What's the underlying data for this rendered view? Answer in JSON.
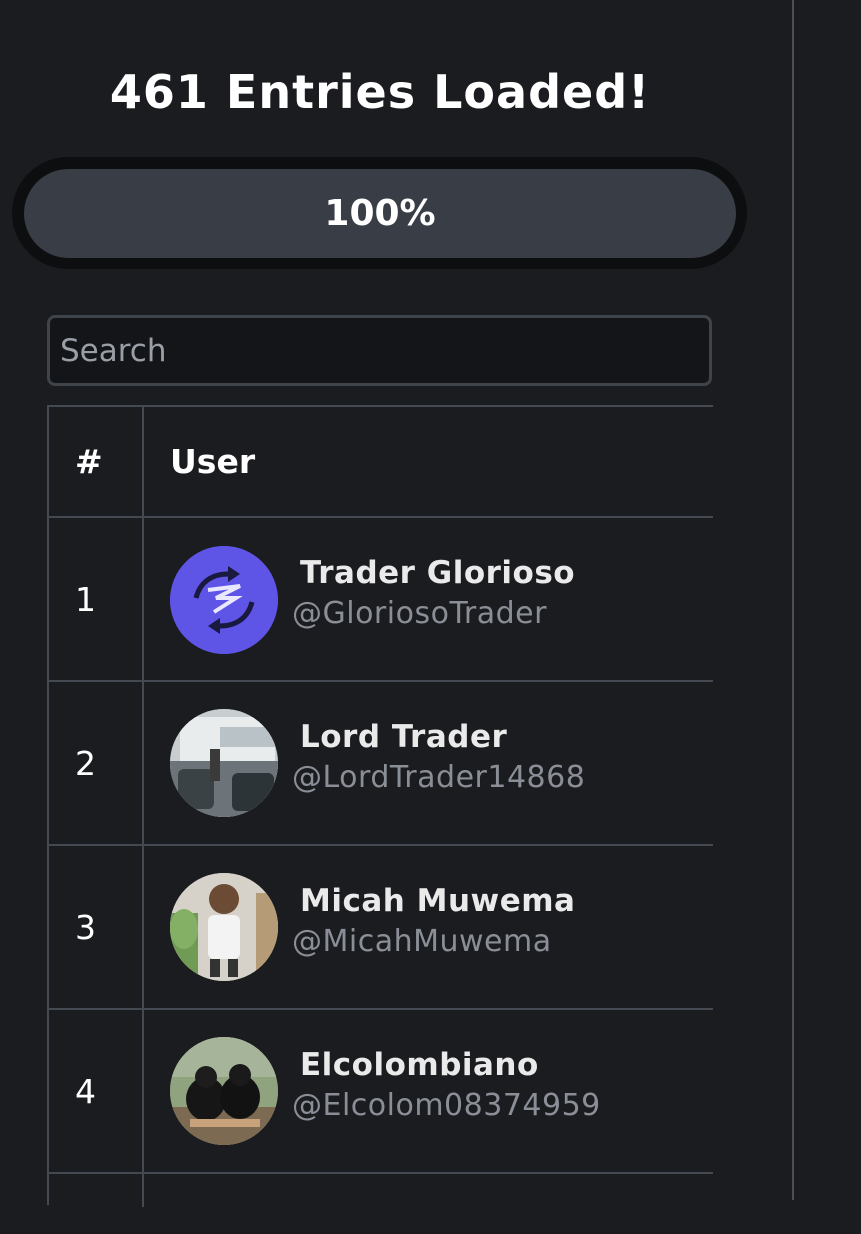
{
  "header": {
    "title": "461 Entries Loaded!"
  },
  "progress": {
    "label": "100%",
    "value": 1.0
  },
  "search": {
    "placeholder": "Search",
    "value": ""
  },
  "table": {
    "columns": [
      "#",
      "User"
    ],
    "rows": [
      {
        "rank": "1",
        "name": "Trader Glorioso",
        "handle": "@GloriosoTrader",
        "avatar": "logo-arrows-avatar"
      },
      {
        "rank": "2",
        "name": "Lord Trader",
        "handle": "@LordTrader14868",
        "avatar": "photo-avatar"
      },
      {
        "rank": "3",
        "name": "Micah Muwema",
        "handle": "@MicahMuwema",
        "avatar": "photo-avatar"
      },
      {
        "rank": "4",
        "name": "Elcolombiano",
        "handle": "@Elcolom08374959",
        "avatar": "photo-avatar"
      }
    ]
  },
  "colors": {
    "background": "#1b1c1f",
    "progress_fill": "#393d45",
    "avatar_1_bg": "#5e54e6",
    "handle_text": "#8a8e96"
  }
}
